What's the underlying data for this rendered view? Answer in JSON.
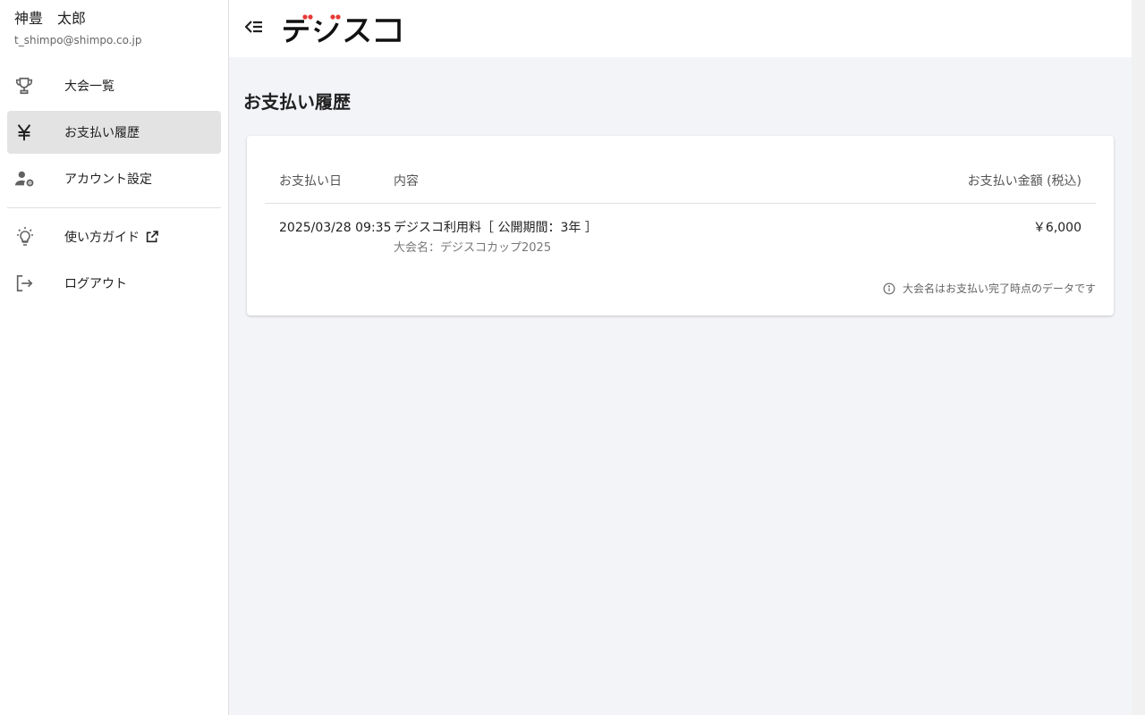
{
  "user": {
    "name": "神豊　太郎",
    "email": "t_shimpo@shimpo.co.jp"
  },
  "sidebar": {
    "items": [
      {
        "label": "大会一覧",
        "icon": "trophy-icon"
      },
      {
        "label": "お支払い履歴",
        "icon": "yen-icon",
        "active": true
      },
      {
        "label": "アカウント設定",
        "icon": "user-settings-icon"
      },
      {
        "label": "使い方ガイド",
        "icon": "lightbulb-icon",
        "external": true
      },
      {
        "label": "ログアウト",
        "icon": "logout-icon"
      }
    ]
  },
  "header": {
    "logo_text": "デジスコ",
    "collapse_icon": "menu-collapse-icon"
  },
  "page": {
    "title": "お支払い履歴"
  },
  "payments": {
    "columns": {
      "date": "お支払い日",
      "content": "内容",
      "amount": "お支払い金額 (税込)"
    },
    "rows": [
      {
        "date": "2025/03/28 09:35",
        "content": "デジスコ利用料［ 公開期間：3年 ］",
        "sub": "大会名：デジスコカップ2025",
        "amount": "￥6,000"
      }
    ],
    "note": "大会名はお支払い完了時点のデータです"
  },
  "colors": {
    "accent": "#e53935",
    "active_bg": "#e3e3e3",
    "page_bg": "#f3f4f8"
  }
}
